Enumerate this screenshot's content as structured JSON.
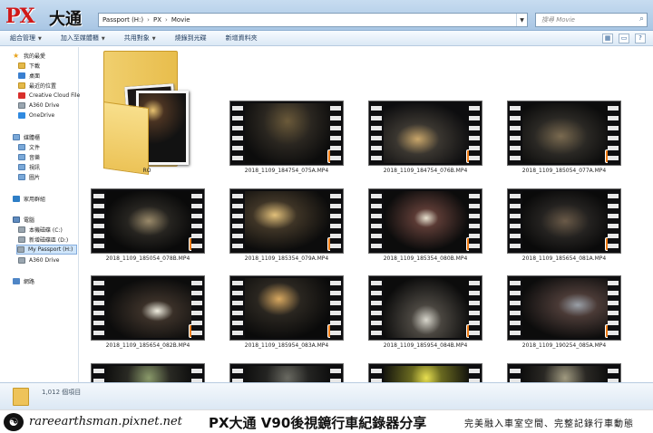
{
  "window": {
    "logo_px": "PX",
    "logo_cn": "大通",
    "breadcrumb": [
      "Passport (H:)",
      "PX",
      "Movie"
    ],
    "search_placeholder": "搜尋 Movie"
  },
  "toolbar": {
    "items": [
      "組合管理",
      "加入至媒體櫃",
      "共用對象",
      "燒錄到光碟",
      "新增資料夾"
    ]
  },
  "sidebar": {
    "items": [
      {
        "label": "我的最愛",
        "icon": "star-icon"
      },
      {
        "label": "下載",
        "icon": "folder-icon"
      },
      {
        "label": "桌面",
        "icon": "desktop-icon"
      },
      {
        "label": "最近的位置",
        "icon": "recent-icon"
      },
      {
        "label": "Creative Cloud File",
        "icon": "creative-cloud-icon"
      },
      {
        "label": "A360 Drive",
        "icon": "drive-icon"
      },
      {
        "label": "OneDrive",
        "icon": "cloud-icon"
      },
      {
        "label": "媒體櫃",
        "icon": "library-icon"
      },
      {
        "label": "文件",
        "icon": "documents-icon"
      },
      {
        "label": "音樂",
        "icon": "music-icon"
      },
      {
        "label": "視訊",
        "icon": "video-icon"
      },
      {
        "label": "圖片",
        "icon": "pictures-icon"
      },
      {
        "label": "家用群組",
        "icon": "homegroup-icon"
      },
      {
        "label": "電腦",
        "icon": "computer-icon"
      },
      {
        "label": "本機磁碟 (C:)",
        "icon": "drive-icon"
      },
      {
        "label": "新增磁碟區 (D:)",
        "icon": "drive-icon"
      },
      {
        "label": "My Passport (H:)",
        "icon": "drive-icon"
      },
      {
        "label": "A360 Drive",
        "icon": "drive-icon"
      },
      {
        "label": "網路",
        "icon": "network-icon"
      }
    ]
  },
  "content": {
    "folder_label": "RO",
    "files": [
      "2018_1109_184754_075A.MP4",
      "2018_1109_184754_076B.MP4",
      "2018_1109_185054_077A.MP4",
      "2018_1109_185054_078B.MP4",
      "2018_1109_185354_079A.MP4",
      "2018_1109_185354_080B.MP4",
      "2018_1109_185654_081A.MP4",
      "2018_1109_185654_082B.MP4",
      "2018_1109_185954_083A.MP4",
      "2018_1109_185954_084B.MP4",
      "2018_1109_190254_085A.MP4"
    ]
  },
  "details": {
    "count": "1,012 個項目"
  },
  "banner": {
    "site": "rareearthsman.pixnet.net",
    "headline": "PX大通 V90後視鏡行車紀錄器分享",
    "slogan": "完美融入車室空間、完整記錄行車動態"
  },
  "colors": {
    "accent": "#f07d16",
    "titlebar": "#a9c6e4",
    "logo_red": "#d01818"
  }
}
